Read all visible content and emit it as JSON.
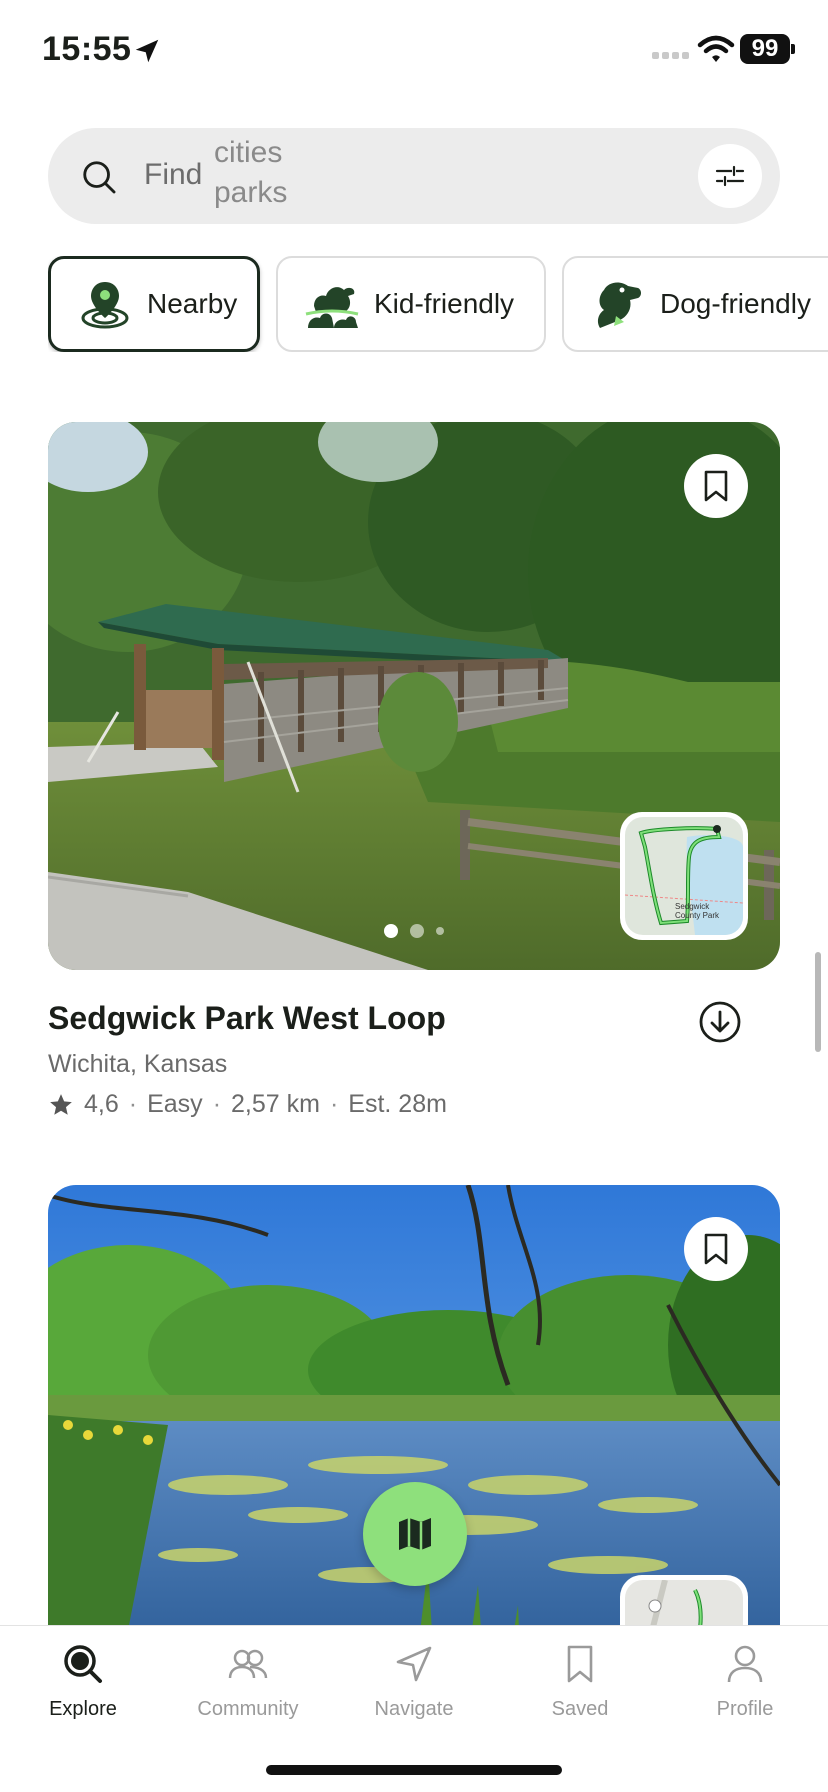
{
  "status_bar": {
    "time": "15:55",
    "battery": "99"
  },
  "search": {
    "find_label": "Find",
    "rotating_suggestions": [
      "cities",
      "parks"
    ]
  },
  "chips": [
    {
      "label": "Nearby",
      "icon": "location-pin-icon",
      "active": true
    },
    {
      "label": "Kid-friendly",
      "icon": "duck-family-icon",
      "active": false
    },
    {
      "label": "Dog-friendly",
      "icon": "dog-icon",
      "active": false
    }
  ],
  "trails": [
    {
      "name": "Sedgwick Park West Loop",
      "location": "Wichita, Kansas",
      "rating": "4,6",
      "difficulty": "Easy",
      "distance": "2,57 km",
      "estimate": "Est. 28m",
      "map_label": "Sedgwick County Park",
      "photo": "covered wooden bridge with green roof"
    },
    {
      "name": "",
      "photo": "pond with lily pads surrounded by trees"
    }
  ],
  "tabs": [
    {
      "label": "Explore",
      "icon": "explore-search-icon",
      "active": true
    },
    {
      "label": "Community",
      "icon": "community-people-icon",
      "active": false
    },
    {
      "label": "Navigate",
      "icon": "navigate-arrow-icon",
      "active": false
    },
    {
      "label": "Saved",
      "icon": "bookmark-icon",
      "active": false
    },
    {
      "label": "Profile",
      "icon": "profile-person-icon",
      "active": false
    }
  ],
  "colors": {
    "accent_green": "#8ee07c",
    "dark_green": "#1b2a1f",
    "inactive_gray": "#9a9a9a"
  }
}
